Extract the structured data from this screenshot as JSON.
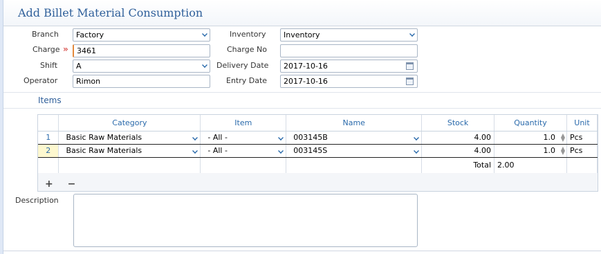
{
  "page": {
    "title": "Add Billet Material Consumption"
  },
  "form": {
    "branch_label": "Branch",
    "branch_value": "Factory",
    "inventory_label": "Inventory",
    "inventory_value": "Inventory",
    "charge_label": "Charge",
    "charge_value": "3461",
    "charge_no_label": "Charge No",
    "charge_no_value": "",
    "shift_label": "Shift",
    "shift_value": "A",
    "delivery_date_label": "Delivery Date",
    "delivery_date_value": "2017-10-16",
    "operator_label": "Operator",
    "operator_value": "Rimon",
    "entry_date_label": "Entry Date",
    "entry_date_value": "2017-10-16",
    "required_marker": "»"
  },
  "items": {
    "section_label": "Items",
    "columns": [
      "Category",
      "Item",
      "Name",
      "Stock",
      "Quantity",
      "Unit"
    ],
    "rows": [
      {
        "num": "1",
        "category": "Basic Raw Materials",
        "item": "- All -",
        "name": "003145B",
        "stock": "4.00",
        "quantity": "1.0",
        "unit": "Pcs"
      },
      {
        "num": "2",
        "category": "Basic Raw Materials",
        "item": "- All -",
        "name": "003145S",
        "stock": "4.00",
        "quantity": "1.0",
        "unit": "Pcs"
      }
    ],
    "total_label": "Total",
    "total_value": "2.00",
    "add_label": "+",
    "remove_label": "−"
  },
  "description": {
    "label": "Description",
    "value": ""
  },
  "icons": [
    "chevron-down-icon",
    "calendar-icon",
    "spinner-icon"
  ],
  "colors": {
    "accent": "#2a6aab",
    "title": "#2f5f9a",
    "required": "#d9534f",
    "active_row": "#fdf8cf"
  }
}
